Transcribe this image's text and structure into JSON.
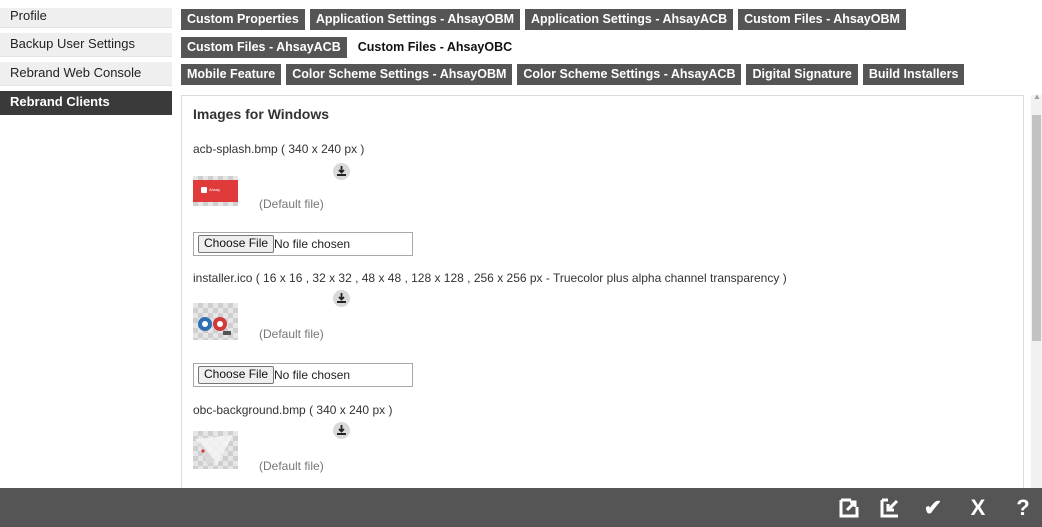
{
  "sidebar": {
    "items": [
      {
        "label": "Profile"
      },
      {
        "label": "Backup User Settings"
      },
      {
        "label": "Rebrand Web Console"
      },
      {
        "label": "Rebrand Clients"
      }
    ]
  },
  "tabs": {
    "row1": [
      "Custom Properties",
      "Application Settings - AhsayOBM",
      "Application Settings - AhsayACB",
      "Custom Files - AhsayOBM"
    ],
    "row2": [
      "Custom Files - AhsayACB",
      "Custom Files - AhsayOBC"
    ],
    "row3": [
      "Mobile Feature",
      "Color Scheme Settings - AhsayOBM",
      "Color Scheme Settings - AhsayACB",
      "Digital Signature",
      "Build Installers"
    ],
    "active": "Custom Files - AhsayOBC"
  },
  "panel": {
    "title": "Images for Windows",
    "files": [
      {
        "label": "acb-splash.bmp  ( 340 x 240  px )",
        "status": "(Default file)",
        "thumb_brand": "Ahsay"
      },
      {
        "label": "installer.ico  ( 16 x 16 , 32 x 32 , 48 x 48 , 128 x 128 , 256 x 256  px  - Truecolor plus alpha channel transparency )",
        "status": "(Default file)"
      },
      {
        "label": "obc-background.bmp  ( 340 x 240  px )",
        "status": "(Default file)"
      }
    ],
    "choose_file_label": "Choose File",
    "no_file_label": "No file chosen"
  },
  "footer": {
    "icons": [
      "export-icon",
      "import-icon",
      "check-icon",
      "close-icon",
      "help-icon"
    ],
    "check_glyph": "✔",
    "close_glyph": "X",
    "help_glyph": "?"
  },
  "colors": {
    "tab_bg": "#555555",
    "sidebar_active": "#3a3a3a",
    "footer_bg": "#555555",
    "splash_red": "#e03a3a"
  }
}
